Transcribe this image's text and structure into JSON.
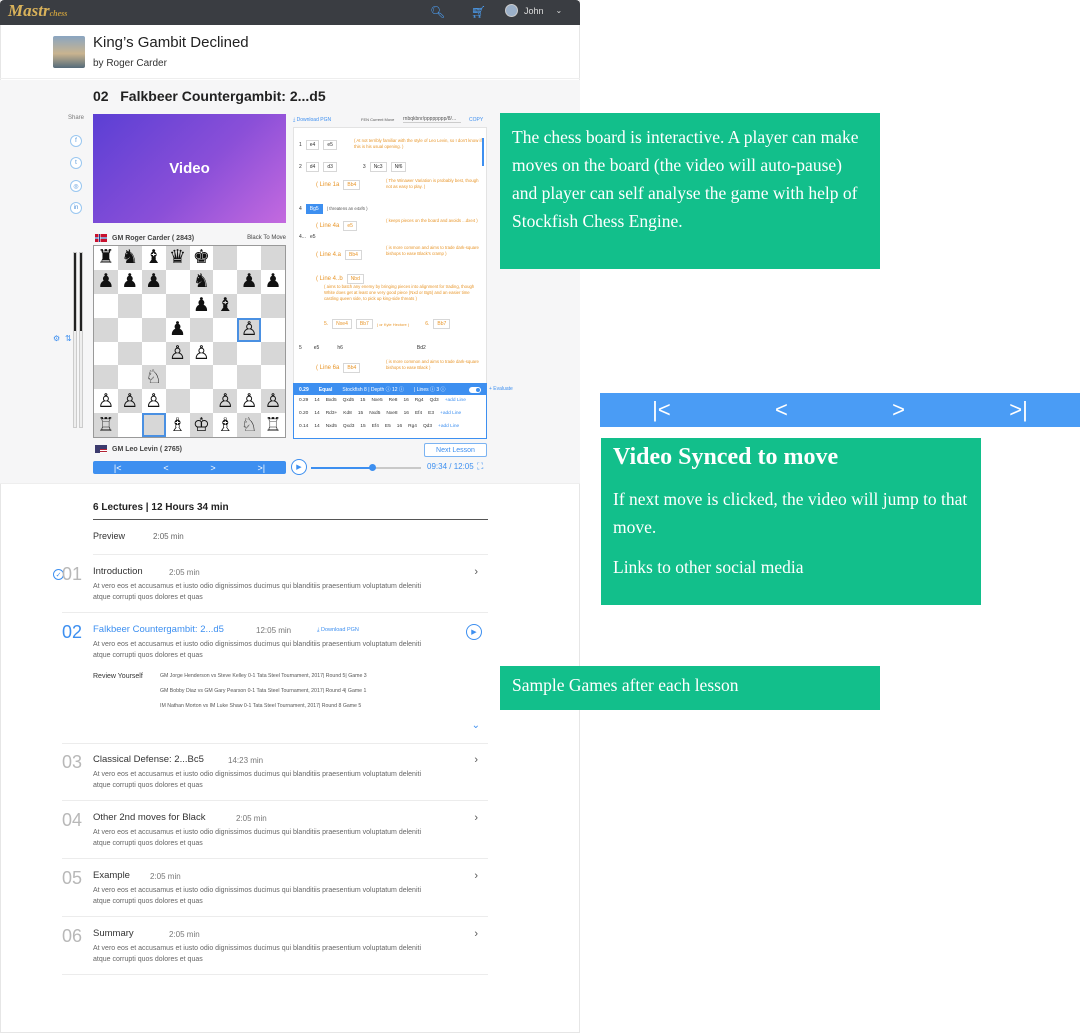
{
  "app": {
    "logo": "Mastr",
    "logo_sub": "chess"
  },
  "header": {
    "user_name": "John",
    "user_caret": "⌄"
  },
  "course": {
    "title": "King’s Gambit Declined",
    "author": "by Roger Carder"
  },
  "lesson": {
    "number": "02",
    "title": "Falkbeer Countergambit: 2...d5"
  },
  "share": {
    "label": "Share",
    "icons": [
      "f",
      "t",
      "◎",
      "in"
    ]
  },
  "video": {
    "label": "Video",
    "time": "09:34 / 12:05",
    "progress_fraction": 0.55
  },
  "players": {
    "black": {
      "name": "GM Roger Carder ( 2843)",
      "status": "Black To Move"
    },
    "white": {
      "name": "GM Leo Levin ( 2765)"
    }
  },
  "board": {
    "rows": [
      [
        "♜",
        "♞",
        "♝",
        "♛",
        "♚",
        "",
        "",
        ""
      ],
      [
        "♟",
        "♟",
        "♟",
        "",
        "♞",
        "",
        "♟",
        "♟"
      ],
      [
        "",
        "",
        "",
        "",
        "♟",
        "♝",
        "",
        ""
      ],
      [
        "",
        "",
        "",
        "♟",
        "",
        "",
        "♙",
        ""
      ],
      [
        "",
        "",
        "",
        "♙",
        "♙",
        "",
        "",
        ""
      ],
      [
        "",
        "",
        "♘",
        "",
        "",
        "",
        "",
        ""
      ],
      [
        "♙",
        "♙",
        "♙",
        "",
        "",
        "♙",
        "♙",
        "♙"
      ],
      [
        "♖",
        "",
        "",
        "♗",
        "♔",
        "♗",
        "♘",
        "♖"
      ]
    ],
    "highlight": [
      [
        3,
        6
      ],
      [
        7,
        2
      ]
    ]
  },
  "eval": {
    "fraction": 0.45
  },
  "nav": {
    "first": "|<",
    "prev": "<",
    "next": ">",
    "last": ">|"
  },
  "next_lesson": "Next Lesson",
  "pgn": {
    "download": "Download PGN",
    "fen_label": "FEN Current Move",
    "fen_value": "rnbqkbnr/pppppppp/8/...",
    "copy": "COPY"
  },
  "moves": {
    "row1": {
      "n": "1",
      "w": "e4",
      "b": "e5",
      "comment": "( At not terribly familiar with the style of Leo Levin, so I don't know if this is his usual opening. )"
    },
    "row2": {
      "n": "2",
      "w": "d4",
      "b": "d3",
      "n2": "3",
      "w2": "Nc3",
      "b2": "Nf6"
    },
    "line1a": {
      "tag": "( Line 1a",
      "chip": "Bb4",
      "comment": "( The Winawer Variation is probably best, though not as easy to play. )"
    },
    "row4": {
      "n": "4",
      "w": "Bg5",
      "comment": "( threatens an e4xf6 )"
    },
    "line4a": {
      "tag": "( Line 4a",
      "chip": "e5",
      "comment": "( keeps pieces on the board and avoids ...dxe4 )"
    },
    "row4b": {
      "n": "4...",
      "w": "e5"
    },
    "line4aa": {
      "tag": "( Line 4.a",
      "chip": "Bb4",
      "comment": "( is more common and aims to trade dark-square bishops to ease Black's cramp )"
    },
    "line4b": {
      "tag": "( Line 4..b",
      "chip": "Nbd",
      "comment": "( aims to batch any enemy by bringing pieces into alignment for trading, though White does get at least one very good piece (Nxd or Bg5) and an easier time castling queen side, to pick up king-side threats )"
    },
    "row5a": {
      "n": "5.",
      "w": "Nxe4",
      "w2": "Bb7",
      "t": "( or Kyle Hectore )",
      "n2": "6.",
      "b2": "Bb7"
    },
    "row5": {
      "n": "5",
      "w": "e5",
      "b": "h6",
      "b2": "Bd2"
    },
    "line6a": {
      "tag": "( Line 6a",
      "chip": "Bb4",
      "comment": "( is more common and aims to trade dark-square bishops to ease Black )"
    }
  },
  "engine": {
    "head": {
      "score": "0.29",
      "label": "Equal",
      "depth": "Stockfish 8 | Depth ⓘ 12 ⓘ",
      "lines": "| Lines ⓘ 3 ⓘ"
    },
    "evaluate": "+ Evaluate",
    "lines": [
      [
        "0.29",
        "14",
        "Bxd5",
        "Qxd5",
        "15",
        "Nxe5",
        "Re8",
        "16",
        "Rg4",
        "Qd3",
        "+add Line"
      ],
      [
        "0.20",
        "14",
        "Rd3+",
        "Kd8",
        "15",
        "Nxd5",
        "Nxe8",
        "16",
        "Ef4",
        "E3",
        "+add Line"
      ],
      [
        "0.14",
        "14",
        "Nxd5",
        "Qxd3",
        "15",
        "Ef4",
        "E5",
        "16",
        "Rg4",
        "Qd3",
        "+add Line"
      ]
    ]
  },
  "stats": "6 Lectures |  12 Hours  34 min",
  "preview": {
    "label": "Preview",
    "duration": "2:05 min"
  },
  "desc": "At vero eos et accusamus et iusto odio dignissimos ducimus qui blanditiis praesentium voluptatum deleniti atque corrupti quos dolores et quas",
  "lectures": [
    {
      "num": "01",
      "title": "Introduction",
      "duration": "2:05 min"
    },
    {
      "num": "02",
      "title": "Falkbeer Countergambit: 2...d5",
      "duration": "12:05 min",
      "download": "Download PGN"
    },
    {
      "num": "03",
      "title": "Classical Defense: 2...Bc5",
      "duration": "14:23 min"
    },
    {
      "num": "04",
      "title": "Other 2nd moves for Black",
      "duration": "2:05 min"
    },
    {
      "num": "05",
      "title": "Example",
      "duration": "2:05 min"
    },
    {
      "num": "06",
      "title": "Summary",
      "duration": "2:05 min"
    }
  ],
  "review": {
    "label": "Review Yourself",
    "games": [
      "GM Jorge Henderson vs Steve Kelley  0-1  Tata Steel Tournament, 2017| Round 5| Game 3",
      "GM Bobby Diaz vs GM Gary Pearson  0-1  Tata Steel Tournament, 2017| Round 4| Game 1",
      "IM Nathan Morton vs IM Luke Shaw  0-1  Tata Steel Tournament, 2017| Round 8 Game 5"
    ]
  },
  "notes": {
    "interactive": "The chess board is interactive. A player can make moves on the board (the video will auto-pause) and player can self analyse the game with help of Stockfish Chess Engine.",
    "synced_title": "Video Synced to move",
    "synced_text": "If next move is clicked, the video will jump to that move.",
    "social_text": "Links to other social media",
    "samples": "Sample Games after each lesson"
  },
  "colors": {
    "accent": "#3d8ff0",
    "note": "#12bf8b",
    "orange": "#e8962a"
  }
}
